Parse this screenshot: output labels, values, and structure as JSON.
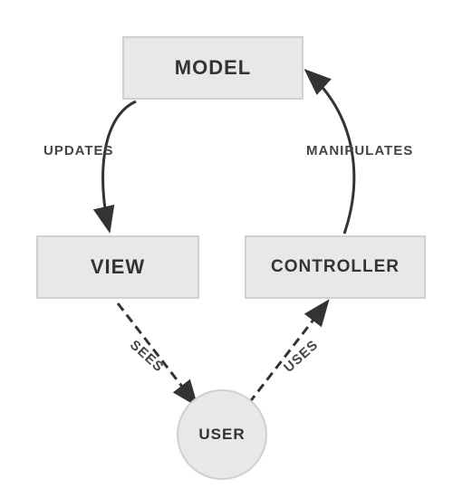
{
  "nodes": {
    "model": "MODEL",
    "view": "VIEW",
    "controller": "CONTROLLER",
    "user": "USER"
  },
  "edges": {
    "model_to_view": "UPDATES",
    "controller_to_model": "MANIPULATES",
    "view_to_user": "SEES",
    "user_to_controller": "USES"
  },
  "colors": {
    "box_bg": "#e8e8e8",
    "box_border": "#d0d0d0",
    "text": "#333333",
    "arrow": "#333333"
  }
}
